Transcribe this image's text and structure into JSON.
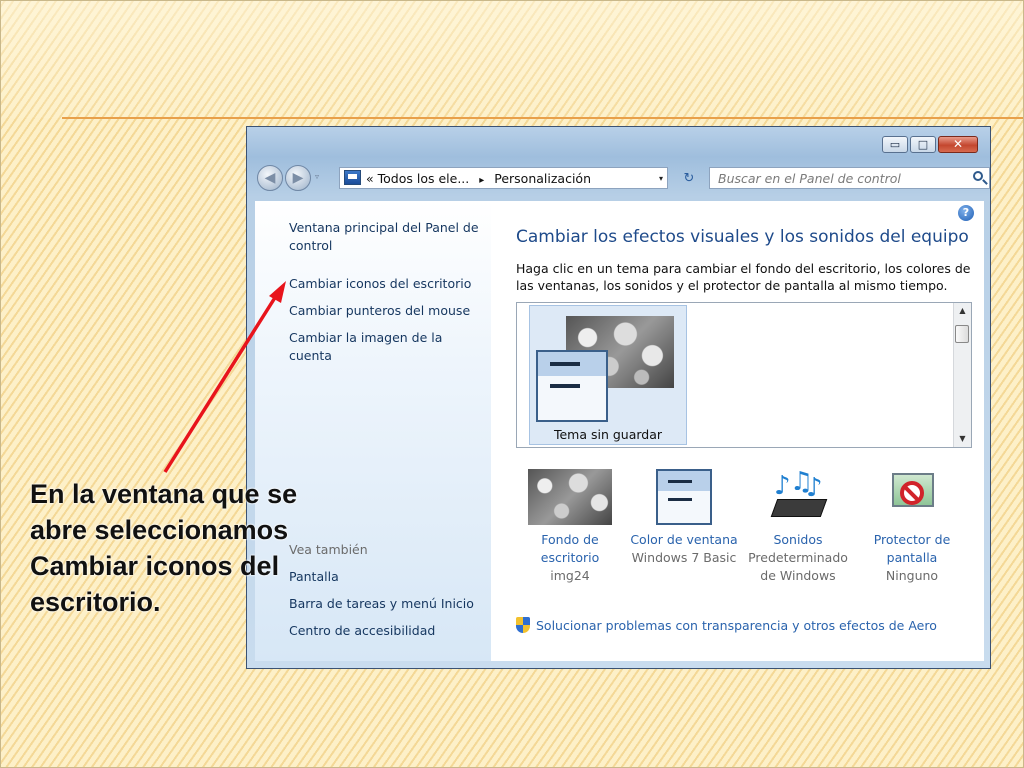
{
  "window": {
    "caption_buttons": {
      "minimize": "▭",
      "maximize": "□",
      "close": "✕"
    },
    "nav": {
      "back_icon": "◀",
      "forward_icon": "▶",
      "drop_icon": "▿"
    },
    "address": {
      "prefix": "«",
      "crumb1": "Todos los ele...",
      "sep": "▸",
      "crumb2": "Personalización",
      "drop": "▾"
    },
    "refresh_icon": "↻",
    "search": {
      "placeholder": "Buscar en el Panel de control"
    }
  },
  "sidebar": {
    "links": [
      "Ventana principal del Panel de\ncontrol",
      "Cambiar iconos del escritorio",
      "Cambiar punteros del mouse",
      "Cambiar la imagen de la\ncuenta"
    ],
    "see_also_heading": "Vea también",
    "see_also": [
      "Pantalla",
      "Barra de tareas y menú Inicio",
      "Centro de accesibilidad"
    ]
  },
  "content": {
    "help": "?",
    "title": "Cambiar los efectos visuales y los sonidos del equipo",
    "description": "Haga clic en un tema para cambiar el fondo del escritorio, los colores de las ventanas, los sonidos y el protector de pantalla al mismo tiempo.",
    "theme": {
      "label": "Tema sin guardar"
    },
    "options": [
      {
        "name": "Fondo de escritorio",
        "value": "img24"
      },
      {
        "name": "Color de ventana",
        "value": "Windows 7 Basic"
      },
      {
        "name": "Sonidos",
        "value": "Predeterminado de Windows"
      },
      {
        "name": "Protector de pantalla",
        "value": "Ninguno"
      }
    ],
    "aero_link": "Solucionar problemas con transparencia y otros efectos de Aero"
  },
  "caption": "En la ventana que se abre seleccionamos Cambiar iconos del escritorio.",
  "colors": {
    "arrow": "#e8141c",
    "link": "#2a63ad",
    "title": "#1e4a8a"
  }
}
